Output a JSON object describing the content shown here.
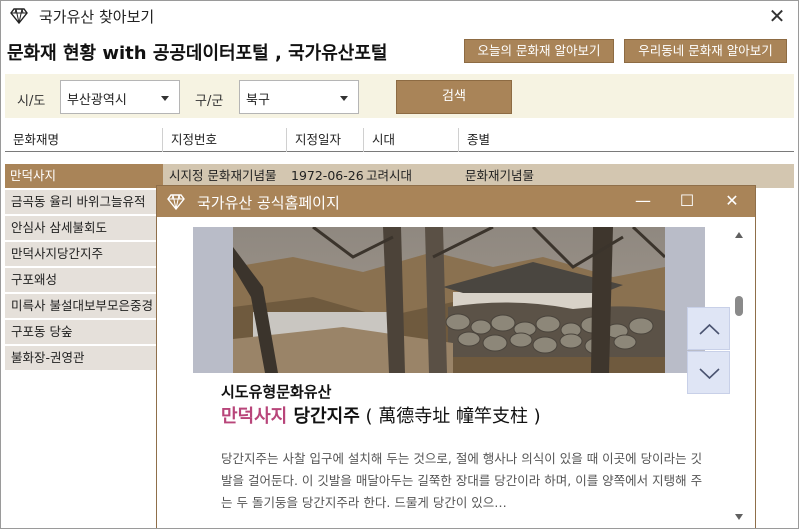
{
  "window": {
    "title": "국가유산 찾아보기",
    "close_label": "✕"
  },
  "header": {
    "page_title": "문화재 현황 with 공공데이터포털 , 국가유산포털",
    "btn_today": "오늘의 문화재 알아보기",
    "btn_local": "우리동네 문화재 알아보기"
  },
  "filter": {
    "sido_label": "시/도",
    "sido_value": "부산광역시",
    "gugun_label": "구/군",
    "gugun_value": "북구",
    "search_label": "검색"
  },
  "table": {
    "headers": [
      "문화재명",
      "지정번호",
      "지정일자",
      "시대",
      "종별"
    ],
    "selected_row": {
      "name": "만덕사지",
      "designation": "시지정 문화재기념물",
      "date": "1972-06-26",
      "era": "고려시대",
      "type": "문화재기념물"
    },
    "items": [
      "금곡동 율리 바위그늘유적",
      "안심사 삼세불회도",
      "만덕사지당간지주",
      "구포왜성",
      "미륵사 불설대보부모은중경",
      "구포동 당숲",
      "불화장-권영관"
    ]
  },
  "popup": {
    "title": "국가유산 공식홈페이지",
    "minimize": "—",
    "maximize": "☐",
    "close": "✕",
    "category": "시도유형문화유산",
    "heading_accent": "만덕사지",
    "heading_rest": " 당간지주",
    "heading_hanja": " ( 萬德寺址 幢竿支柱 )",
    "description": "당간지주는 사찰 입구에 설치해 두는 것으로, 절에 행사나 의식이 있을 때 이곳에 당이라는 깃발을 걸어둔다. 이 깃발을 매달아두는 길쭉한 장대를 당간이라 하며, 이를 양쪽에서 지탱해 주는 두 돌기둥을 당간지주라 한다. 드물게 당간이 있으…"
  },
  "colors": {
    "accent": "#a98458",
    "selected_row": "#d3c6b0",
    "list_item": "#e5e0da",
    "heading_accent": "#b8457a",
    "filter_bg": "#f6f3e2"
  },
  "icons": [
    "gem-icon",
    "close-icon",
    "minimize-icon",
    "maximize-icon",
    "chevron-up-icon",
    "chevron-down-icon",
    "dropdown-arrow-icon"
  ]
}
